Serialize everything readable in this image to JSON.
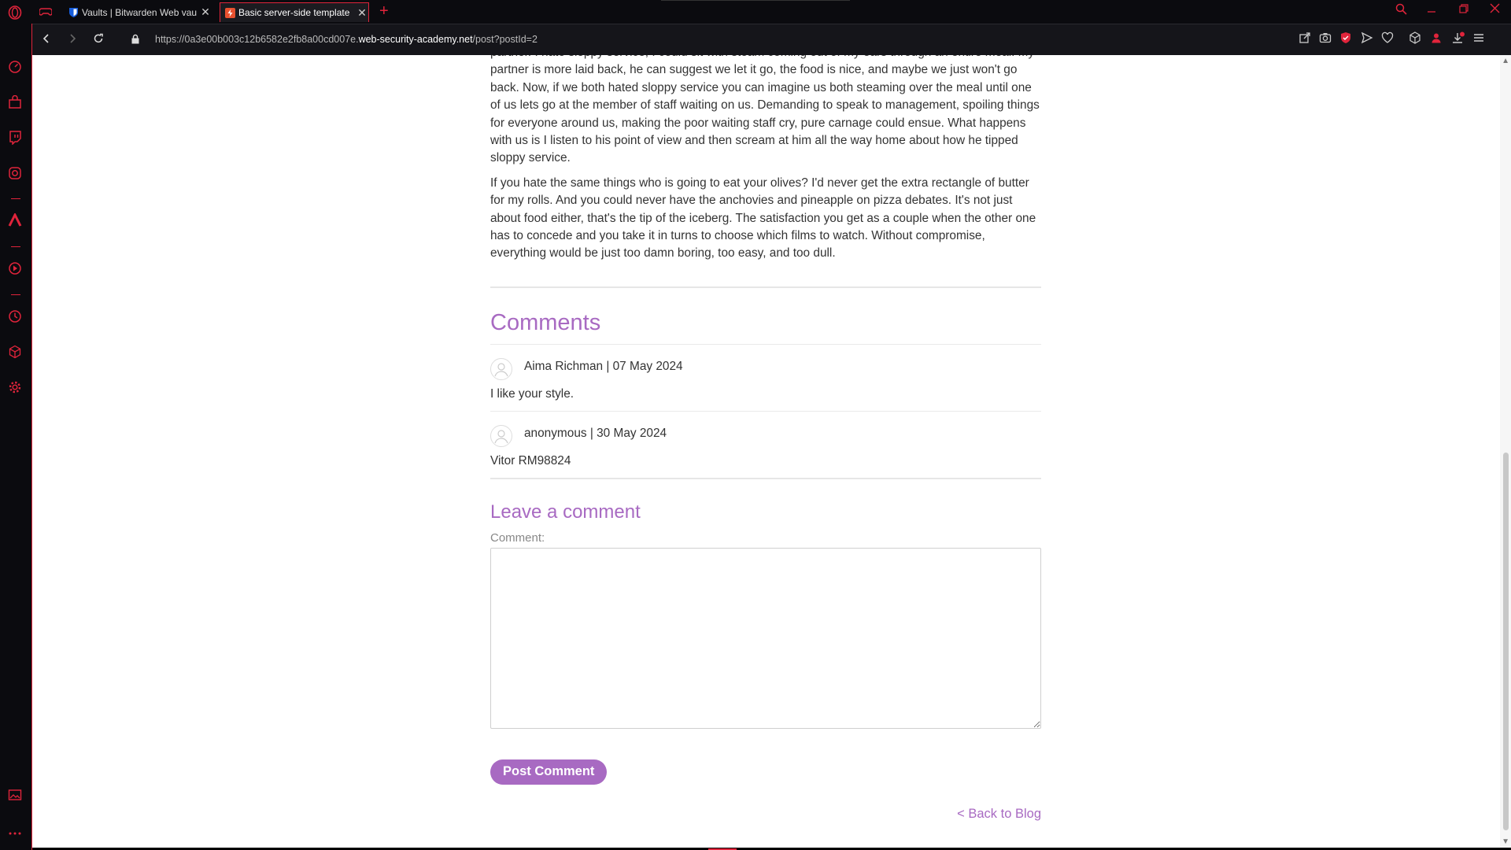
{
  "browser": {
    "tabs": [
      {
        "title": "Vaults | Bitwarden Web vau",
        "favicon_color": "#175ddc"
      },
      {
        "title": "Basic server-side template",
        "favicon_color": "#e8512f",
        "active": true
      }
    ],
    "new_tab_label": "+",
    "url_prefix": "https://0a3e00b003c12b6582e2fb8a00cd007e.",
    "url_host": "web-security-academy.net",
    "url_path": "/post?postId=2",
    "accent_color": "#e0243b"
  },
  "article": {
    "paragraphs": [
      "partner. I hate sloppy service, I could sit with steam coming out of my ears through an entire meal. My partner is more laid back, he can suggest we let it go, the food is nice, and maybe we just won't go back. Now, if we both hated sloppy service you can imagine us both steaming over the meal until one of us lets go at the member of staff waiting on us. Demanding to speak to management, spoiling things for everyone around us, making the poor waiting staff cry, pure carnage could ensue. What happens with us is I listen to his point of view and then scream at him all the way home about how he tipped sloppy service.",
      "If you hate the same things who is going to eat your olives? I'd never get the extra rectangle of butter for my rolls. And you could never have the anchovies and pineapple on pizza debates. It's not just about food either, that's the tip of the iceberg. The satisfaction you get as a couple when the other one has to concede and you take it in turns to choose which films to watch. Without compromise, everything would be just too damn boring, too easy, and too dull."
    ]
  },
  "comments": {
    "title": "Comments",
    "items": [
      {
        "header": "Aima Richman | 07 May 2024",
        "body": "I like your style."
      },
      {
        "header": "anonymous | 30 May 2024",
        "body": "Vitor RM98824"
      }
    ]
  },
  "leave_comment": {
    "title": "Leave a comment",
    "label": "Comment:",
    "value": "",
    "button": "Post Comment"
  },
  "back_link": "< Back to Blog",
  "theme": {
    "link_purple": "#a86ac2",
    "text": "#333333"
  }
}
